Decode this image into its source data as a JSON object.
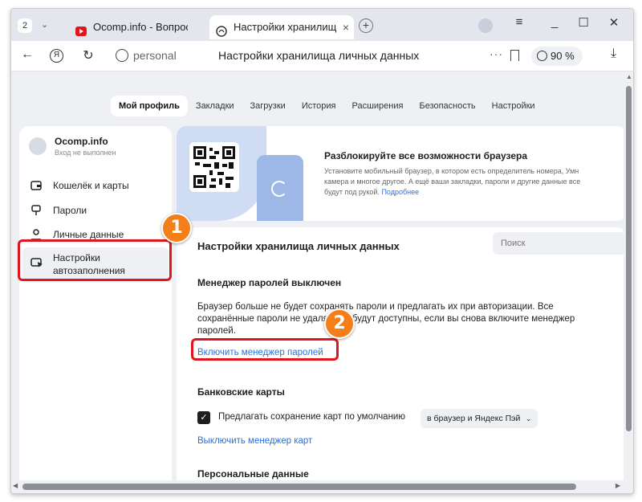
{
  "tabstrip": {
    "tab_count": "2",
    "tabs": [
      {
        "title": "Ocomp.info - Вопросы адм"
      },
      {
        "title": "Настройки хранилища"
      }
    ]
  },
  "addressbar": {
    "domain": "personal",
    "page_title": "Настройки хранилища личных данных",
    "dots": "···",
    "zoom": "90 %"
  },
  "topnav": {
    "items": [
      "Мой профиль",
      "Закладки",
      "Загрузки",
      "История",
      "Расширения",
      "Безопасность",
      "Настройки"
    ],
    "active": "Мой профиль"
  },
  "sidebar": {
    "account_name": "Ocomp.info",
    "account_status": "Вход не выполнен",
    "items": [
      {
        "label": "Кошелёк и карты",
        "icon": "wallet-icon"
      },
      {
        "label": "Пароли",
        "icon": "key-icon"
      },
      {
        "label": "Личные данные",
        "icon": "person-icon"
      },
      {
        "label": "Настройки",
        "label2": "автозаполнения",
        "icon": "autofill-icon"
      }
    ]
  },
  "promo": {
    "title": "Разблокируйте все возможности браузера",
    "lines": [
      "Установите мобильный браузер, в котором есть определитель номера, Умн",
      "камера и многое другое. А ещё ваши закладки, пароли и другие данные все",
      "будут под рукой. "
    ],
    "link": "Подробнее"
  },
  "settings": {
    "title": "Настройки хранилища личных данных",
    "search_placeholder": "Поиск",
    "password_manager": {
      "title": "Менеджер паролей выключен",
      "lines": [
        "Браузер больше не будет сохранять пароли и предлагать их при авторизации. Все",
        "сохранённые пароли не удалятся и будут доступны, если вы снова включите менеджер",
        "паролей."
      ],
      "enable_link": "Включить менеджер паролей"
    },
    "bank_cards": {
      "title": "Банковские карты",
      "checkbox_label": "Предлагать сохранение карт по умолчанию",
      "checked": true,
      "select_value": "в браузер и Яндекс Пэй",
      "disable_link": "Выключить менеджер карт"
    },
    "personal_data": {
      "title": "Персональные данные"
    }
  },
  "annotations": {
    "badge1": "1",
    "badge2": "2",
    "highlight_color": "#e0161c",
    "badge_color": "#f47e1a"
  }
}
